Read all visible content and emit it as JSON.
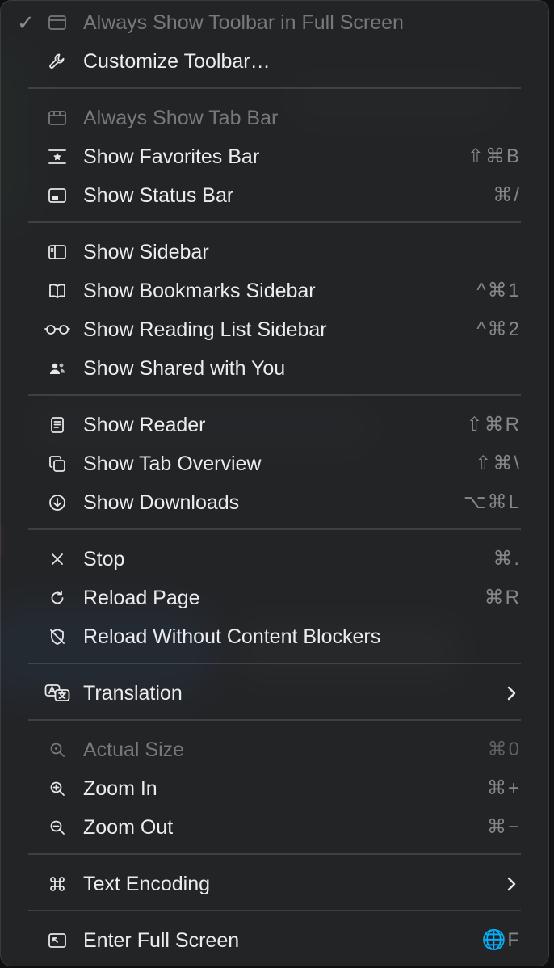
{
  "menu": {
    "items": [
      {
        "label": "Always Show Toolbar in Full Screen",
        "checked": "✓",
        "icon": "window-icon",
        "enabled": false
      },
      {
        "label": "Customize Toolbar…",
        "icon": "wrench-icon",
        "enabled": true
      },
      {
        "label": "Always Show Tab Bar",
        "icon": "tab-bar-icon",
        "enabled": false
      },
      {
        "label": "Show Favorites Bar",
        "icon": "favorites-bar-icon",
        "shortcut": "⇧⌘B",
        "enabled": true
      },
      {
        "label": "Show Status Bar",
        "icon": "status-bar-icon",
        "shortcut": "⌘/",
        "enabled": true
      },
      {
        "label": "Show Sidebar",
        "icon": "sidebar-icon",
        "enabled": true
      },
      {
        "label": "Show Bookmarks Sidebar",
        "icon": "book-icon",
        "shortcut": "^⌘1",
        "enabled": true
      },
      {
        "label": "Show Reading List Sidebar",
        "icon": "glasses-icon",
        "shortcut": "^⌘2",
        "enabled": true
      },
      {
        "label": "Show Shared with You",
        "icon": "shared-people-icon",
        "enabled": true
      },
      {
        "label": "Show Reader",
        "icon": "reader-icon",
        "shortcut": "⇧⌘R",
        "enabled": true
      },
      {
        "label": "Show Tab Overview",
        "icon": "tab-overview-icon",
        "shortcut": "⇧⌘\\",
        "enabled": true
      },
      {
        "label": "Show Downloads",
        "icon": "download-icon",
        "shortcut": "⌥⌘L",
        "enabled": true
      },
      {
        "label": "Stop",
        "icon": "close-icon",
        "shortcut": "⌘.",
        "enabled": true
      },
      {
        "label": "Reload Page",
        "icon": "reload-icon",
        "shortcut": "⌘R",
        "enabled": true
      },
      {
        "label": "Reload Without Content Blockers",
        "icon": "shield-slash-icon",
        "enabled": true
      },
      {
        "label": "Translation",
        "icon": "translate-icon",
        "submenu": true,
        "enabled": true
      },
      {
        "label": "Actual Size",
        "icon": "zoom-actual-icon",
        "shortcut": "⌘0",
        "enabled": false
      },
      {
        "label": "Zoom In",
        "icon": "zoom-in-icon",
        "shortcut": "⌘+",
        "enabled": true
      },
      {
        "label": "Zoom Out",
        "icon": "zoom-out-icon",
        "shortcut": "⌘−",
        "enabled": true
      },
      {
        "label": "Text Encoding",
        "icon": "command-icon",
        "submenu": true,
        "enabled": true
      },
      {
        "label": "Enter Full Screen",
        "icon": "fullscreen-icon",
        "shortcut": "🌐F",
        "enabled": true
      }
    ]
  },
  "colors": {
    "menu_background": "#262729",
    "text": "#ececee",
    "text_disabled": "#77787b",
    "shortcut": "#86878a"
  }
}
